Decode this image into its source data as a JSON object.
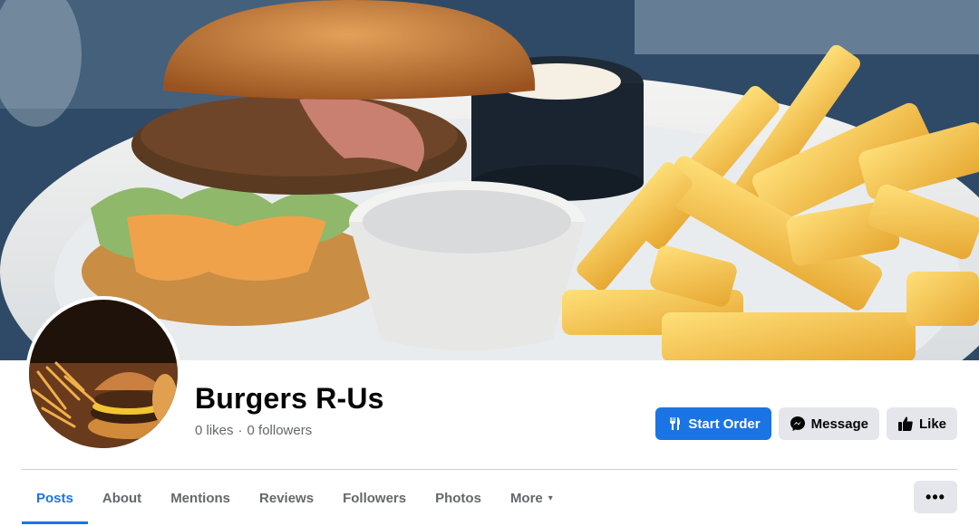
{
  "page": {
    "name": "Burgers R-Us",
    "likes": "0 likes",
    "separator": "·",
    "followers": "0 followers"
  },
  "actions": {
    "start_order": {
      "label": "Start Order",
      "icon": "utensils-icon"
    },
    "message": {
      "label": "Message",
      "icon": "messenger-icon"
    },
    "like": {
      "label": "Like",
      "icon": "thumbs-up-icon"
    }
  },
  "tabs": [
    {
      "label": "Posts",
      "active": true
    },
    {
      "label": "About"
    },
    {
      "label": "Mentions"
    },
    {
      "label": "Reviews"
    },
    {
      "label": "Followers"
    },
    {
      "label": "Photos"
    },
    {
      "label": "More",
      "caret": "▾"
    }
  ],
  "overflow": {
    "label": "•••"
  },
  "colors": {
    "accent": "#1b74e4",
    "secondary_button": "#e4e6eb",
    "muted_text": "#65676b",
    "divider": "#ced0d4"
  }
}
